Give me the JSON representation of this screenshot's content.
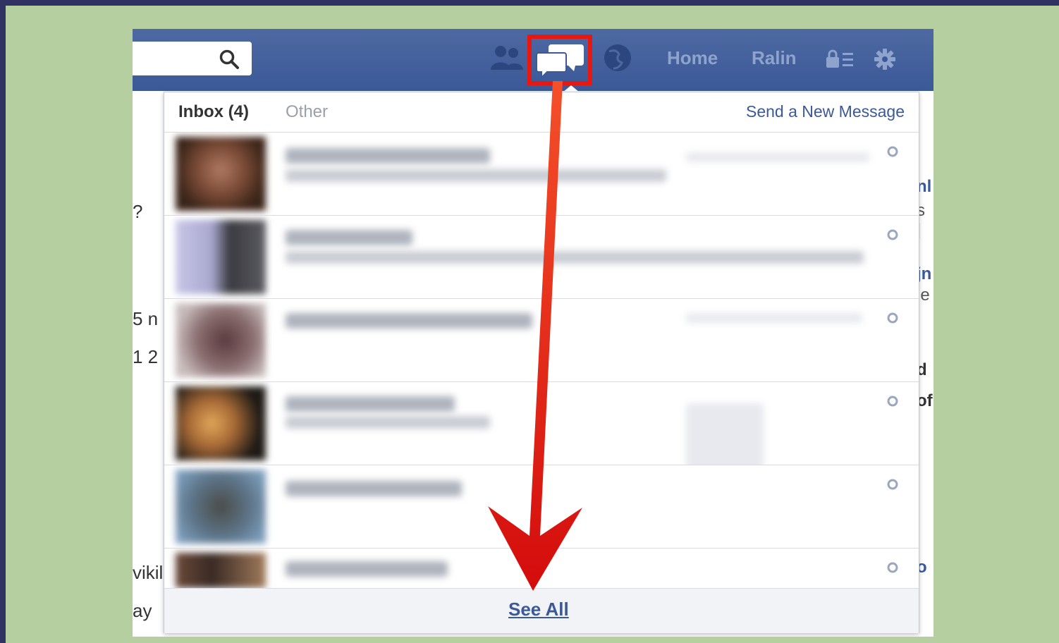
{
  "nav": {
    "home_label": "Home",
    "user_label": "Ralin",
    "icons": [
      "search-icon",
      "friends-icon",
      "messages-icon",
      "globe-icon",
      "privacy-icon",
      "settings-icon"
    ]
  },
  "background_fragments": {
    "left": [
      "?",
      "5 n",
      "1 2",
      "vikil",
      "ay"
    ],
    "right": [
      "nl",
      "s |",
      "jn",
      "le",
      "d",
      "of",
      "o"
    ]
  },
  "messages_panel": {
    "inbox_label": "Inbox (4)",
    "other_label": "Other",
    "send_new_label": "Send a New Message",
    "see_all_label": "See All"
  },
  "colors": {
    "facebook_blue": "#3b5998",
    "highlight_red": "#e8170f",
    "frame_green": "#b6cfa0",
    "border_navy": "#2f3262"
  }
}
